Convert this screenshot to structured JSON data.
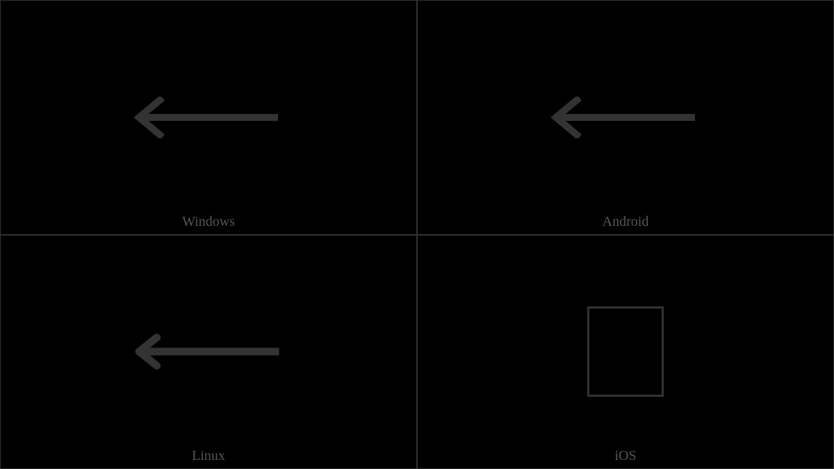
{
  "cells": [
    {
      "label": "Windows",
      "glyph": "left-arrow"
    },
    {
      "label": "Android",
      "glyph": "left-arrow"
    },
    {
      "label": "Linux",
      "glyph": "left-arrow"
    },
    {
      "label": "iOS",
      "glyph": "missing"
    }
  ]
}
